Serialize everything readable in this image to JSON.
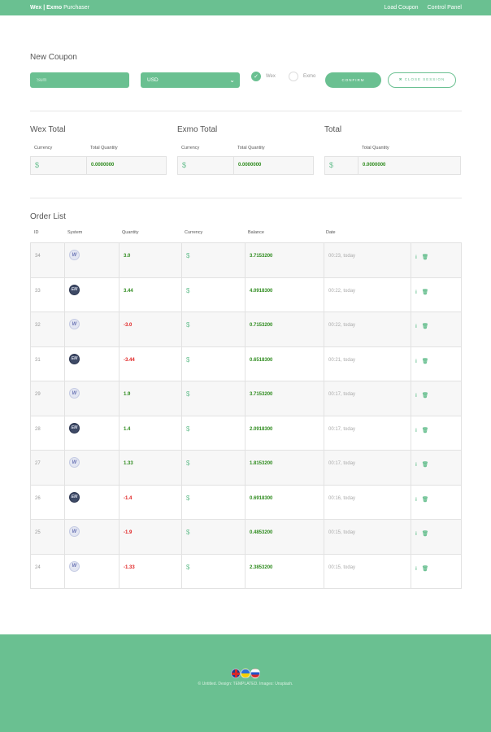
{
  "topbar": {
    "brand_bold": "Wex | Exmo",
    "brand_rest": " Purchaser",
    "nav": [
      "Load Coupon",
      "Control Panel"
    ]
  },
  "new_coupon": {
    "title": "New Coupon",
    "sum_placeholder": "Sum",
    "currency_selected": "USD",
    "radio_wex": "Wex",
    "radio_exmo": "Exmo",
    "radio_selected": "Wex",
    "confirm_label": "CONFIRM",
    "close_label": "CLOSE SESSION"
  },
  "totals": [
    {
      "title": "Wex Total",
      "currency_header": "Currency",
      "quantity_header": "Total Quantity",
      "currency": "$",
      "quantity": "0.0000000"
    },
    {
      "title": "Exmo Total",
      "currency_header": "Currency",
      "quantity_header": "Total Quantity",
      "currency": "$",
      "quantity": "0.0000000"
    },
    {
      "title": "Total",
      "currency_header": "",
      "quantity_header": "Total Quantity",
      "currency": "$",
      "quantity": "0.0000000"
    }
  ],
  "orders": {
    "title": "Order List",
    "columns": [
      "ID",
      "System",
      "Quantity",
      "Currency",
      "Balance",
      "Date"
    ],
    "rows": [
      {
        "id": "34",
        "system": "W",
        "quantity": "3.0",
        "currency": "$",
        "balance": "3.7153200",
        "date": "00:23, today"
      },
      {
        "id": "33",
        "system": "EM",
        "quantity": "3.44",
        "currency": "$",
        "balance": "4.0918300",
        "date": "00:22, today"
      },
      {
        "id": "32",
        "system": "W",
        "quantity": "-3.0",
        "currency": "$",
        "balance": "0.7153200",
        "date": "00:22, today"
      },
      {
        "id": "31",
        "system": "EM",
        "quantity": "-3.44",
        "currency": "$",
        "balance": "0.6518300",
        "date": "00:21, today"
      },
      {
        "id": "29",
        "system": "W",
        "quantity": "1.9",
        "currency": "$",
        "balance": "3.7153200",
        "date": "00:17, today"
      },
      {
        "id": "28",
        "system": "EM",
        "quantity": "1.4",
        "currency": "$",
        "balance": "2.0918300",
        "date": "00:17, today"
      },
      {
        "id": "27",
        "system": "W",
        "quantity": "1.33",
        "currency": "$",
        "balance": "1.8153200",
        "date": "00:17, today"
      },
      {
        "id": "26",
        "system": "EM",
        "quantity": "-1.4",
        "currency": "$",
        "balance": "0.6918300",
        "date": "00:16, today"
      },
      {
        "id": "25",
        "system": "W",
        "quantity": "-1.9",
        "currency": "$",
        "balance": "0.4853200",
        "date": "00:15, today"
      },
      {
        "id": "24",
        "system": "W",
        "quantity": "-1.33",
        "currency": "$",
        "balance": "2.3853200",
        "date": "00:15, today"
      }
    ],
    "action_info_icon": "i",
    "action_delete_icon": "🗑"
  },
  "footer": {
    "credit": "© Untitled. Design: TEMPLATED. Images: Unsplash."
  },
  "colors": {
    "accent": "#6ac091",
    "positive": "#2e8b1e",
    "negative": "#e02020"
  }
}
